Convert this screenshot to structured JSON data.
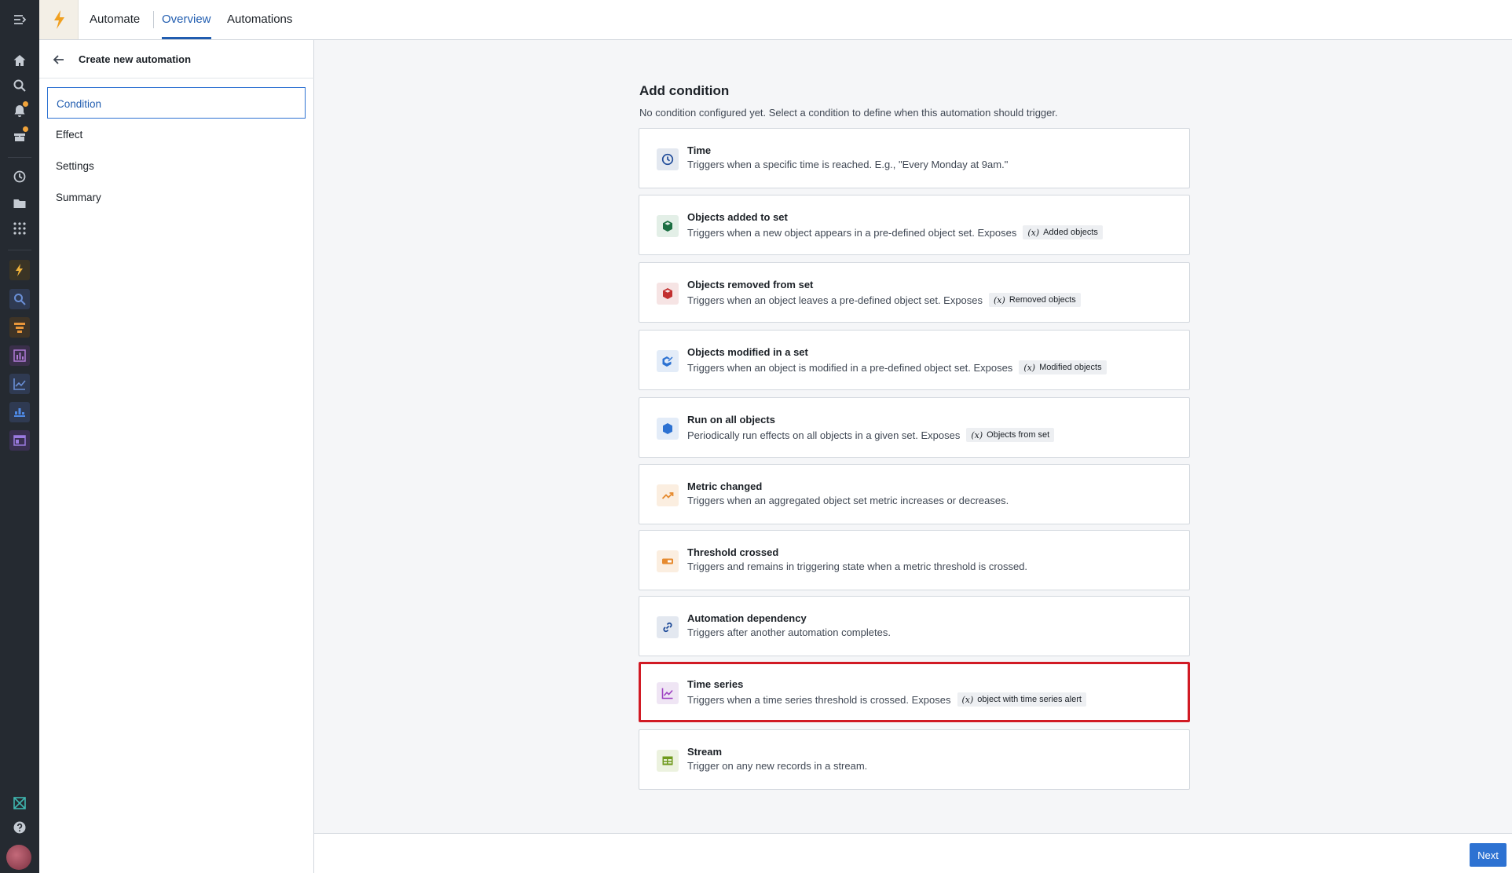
{
  "topbar": {
    "app_name": "Automate",
    "tabs": [
      {
        "label": "Overview",
        "active": true
      },
      {
        "label": "Automations",
        "active": false
      }
    ]
  },
  "sidebar": {
    "title": "Create new automation",
    "steps": [
      {
        "label": "Condition",
        "active": true
      },
      {
        "label": "Effect",
        "active": false
      },
      {
        "label": "Settings",
        "active": false
      },
      {
        "label": "Summary",
        "active": false
      }
    ]
  },
  "main": {
    "heading": "Add condition",
    "subheading": "No condition configured yet. Select a condition to define when this automation should trigger.",
    "conditions": [
      {
        "icon": "clock-icon",
        "title": "Time",
        "desc": "Triggers when a specific time is reached. E.g., \"Every Monday at 9am.\"",
        "tag": "",
        "icon_color": "#1f4b99",
        "icon_bg": "#e3e8f0"
      },
      {
        "icon": "cube-add-icon",
        "title": "Objects added to set",
        "desc": "Triggers when a new object appears in a pre-defined object set. Exposes",
        "tag": "Added objects",
        "icon_color": "#1c6e42",
        "icon_bg": "#e3efe7"
      },
      {
        "icon": "cube-remove-icon",
        "title": "Objects removed from set",
        "desc": "Triggers when an object leaves a pre-defined object set. Exposes",
        "tag": "Removed objects",
        "icon_color": "#c23030",
        "icon_bg": "#f6e4e4"
      },
      {
        "icon": "cube-edit-icon",
        "title": "Objects modified in a set",
        "desc": "Triggers when an object is modified in a pre-defined object set. Exposes",
        "tag": "Modified objects",
        "icon_color": "#2d72d2",
        "icon_bg": "#e3ecf8"
      },
      {
        "icon": "cube-icon",
        "title": "Run on all objects",
        "desc": "Periodically run effects on all objects in a given set. Exposes",
        "tag": "Objects from set",
        "icon_color": "#2d72d2",
        "icon_bg": "#e3ecf8"
      },
      {
        "icon": "trend-up-icon",
        "title": "Metric changed",
        "desc": "Triggers when an aggregated object set metric increases or decreases.",
        "tag": "",
        "icon_color": "#e68a2e",
        "icon_bg": "#fbeee0"
      },
      {
        "icon": "threshold-icon",
        "title": "Threshold crossed",
        "desc": "Triggers and remains in triggering state when a metric threshold is crossed.",
        "tag": "",
        "icon_color": "#e68a2e",
        "icon_bg": "#fbeee0"
      },
      {
        "icon": "link-icon",
        "title": "Automation dependency",
        "desc": "Triggers after another automation completes.",
        "tag": "",
        "icon_color": "#1f4b99",
        "icon_bg": "#e3e8f0"
      },
      {
        "icon": "timeline-icon",
        "title": "Time series",
        "desc": "Triggers when a time series threshold is crossed. Exposes",
        "tag": "object with time series alert",
        "icon_color": "#9d3fc1",
        "icon_bg": "#efe5f4",
        "selected": true
      },
      {
        "icon": "table-icon",
        "title": "Stream",
        "desc": "Trigger on any new records in a stream.",
        "tag": "",
        "icon_color": "#6f9a1e",
        "icon_bg": "#ecf2df"
      }
    ]
  },
  "footer": {
    "next_label": "Next"
  },
  "colors": {
    "accent": "#2d72d2",
    "selection_outline": "#d11a24",
    "rail_bg": "#252a31"
  }
}
